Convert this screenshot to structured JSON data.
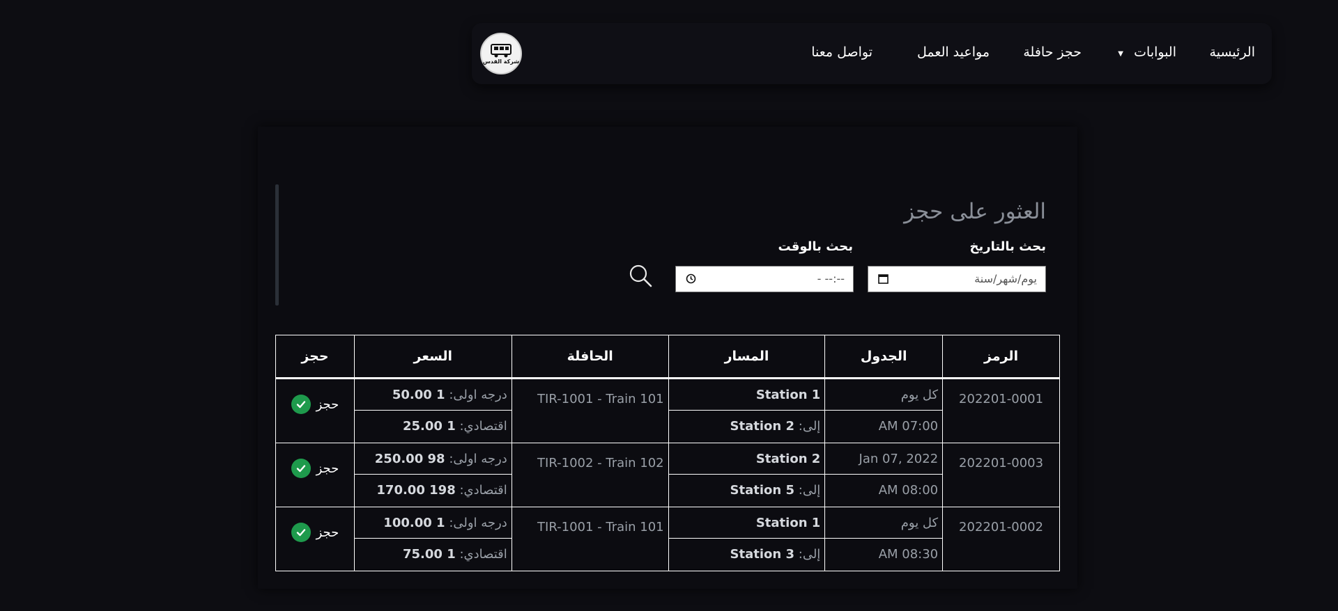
{
  "nav": {
    "logo_text": "شركة القدس",
    "items": [
      "الرئيسية",
      "البوابات",
      "حجز حافلة",
      "مواعيد العمل",
      "تواصل معنا"
    ]
  },
  "search": {
    "title": "العثور على حجز",
    "date_label": "بحث بالتاريخ",
    "date_placeholder": "يوم/شهر/سنة",
    "time_label": "بحث بالوقت",
    "time_placeholder": "--:-- -"
  },
  "table": {
    "headers": [
      "الرمز",
      "الجدول",
      "المسار",
      "الحافلة",
      "السعر",
      "حجز"
    ],
    "prefix_to": "إلى:",
    "prefix_first": "درجه اولى:",
    "prefix_economy": "اقتصادي:",
    "book_label": "حجز",
    "rows": [
      {
        "code": "202201-0001",
        "schedule_date": "كل يوم",
        "schedule_time": "07:00 AM",
        "from": "Station 1",
        "to": "Station 2",
        "bus": "TIR-1001 - Train 101",
        "first_price": "1 50.00",
        "economy_price": "1 25.00"
      },
      {
        "code": "202201-0003",
        "schedule_date": "Jan 07, 2022",
        "schedule_time": "08:00 AM",
        "from": "Station 2",
        "to": "Station 5",
        "bus": "TIR-1002 - Train 102",
        "first_price": "98 250.00",
        "economy_price": "198 170.00"
      },
      {
        "code": "202201-0002",
        "schedule_date": "كل يوم",
        "schedule_time": "08:30 AM",
        "from": "Station 1",
        "to": "Station 3",
        "bus": "TIR-1001 - Train 101",
        "first_price": "1 100.00",
        "economy_price": "1 75.00"
      }
    ]
  },
  "colors": {
    "background": "#0d0d12",
    "check_green": "#1e9a4c",
    "muted_text": "#9aa0a8"
  }
}
